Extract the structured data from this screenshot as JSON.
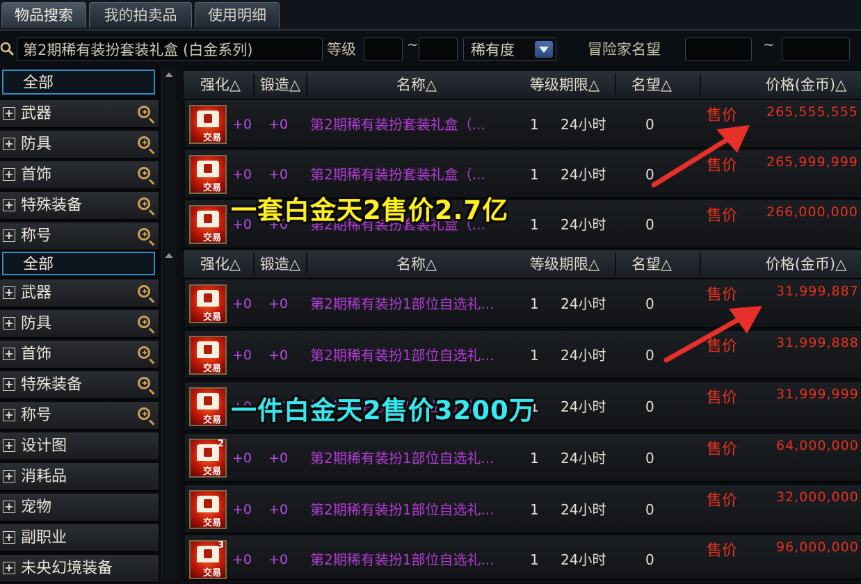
{
  "tabs": [
    {
      "label": "物品搜索",
      "active": true
    },
    {
      "label": "我的拍卖品",
      "active": false
    },
    {
      "label": "使用明细",
      "active": false
    }
  ],
  "search": {
    "value": "第2期稀有装扮套装礼盒 (白金系列)",
    "level_label": "等级",
    "tilde": "~",
    "rarity_label": "稀有度",
    "fame_label": "冒险家名望"
  },
  "sidebar": {
    "group1": {
      "all": "全部",
      "items": [
        "武器",
        "防具",
        "首饰",
        "特殊装备",
        "称号"
      ]
    },
    "group2": {
      "all": "全部",
      "items": [
        "武器",
        "防具",
        "首饰",
        "特殊装备",
        "称号",
        "设计图",
        "消耗品",
        "宠物",
        "副职业",
        "未央幻境装备"
      ]
    }
  },
  "columns": {
    "enhance": "强化△",
    "forge": "锻造△",
    "name": "名称△",
    "level_duration": "等级期限△",
    "fame": "名望△",
    "price": "价格(金币)△"
  },
  "item_icon_label": "交易",
  "sell_label": "售价",
  "table1": [
    {
      "enhance": "+0",
      "forge": "+0",
      "name": "第2期稀有装扮套装礼盒（...",
      "level": "1",
      "duration": "24小时",
      "fame": "0",
      "price": "265,555,555"
    },
    {
      "enhance": "+0",
      "forge": "+0",
      "name": "第2期稀有装扮套装礼盒（...",
      "level": "1",
      "duration": "24小时",
      "fame": "0",
      "price": "265,999,999"
    },
    {
      "enhance": "+0",
      "forge": "+0",
      "name": "第2期稀有装扮套装礼盒（...",
      "level": "1",
      "duration": "24小时",
      "fame": "0",
      "price": "266,000,000"
    }
  ],
  "table2": [
    {
      "enhance": "+0",
      "forge": "+0",
      "name": "第2期稀有装扮1部位自选礼...",
      "level": "1",
      "duration": "24小时",
      "fame": "0",
      "price": "31,999,887",
      "count": ""
    },
    {
      "enhance": "+0",
      "forge": "+0",
      "name": "第2期稀有装扮1部位自选礼...",
      "level": "1",
      "duration": "24小时",
      "fame": "0",
      "price": "31,999,888",
      "count": ""
    },
    {
      "enhance": "+0",
      "forge": "+0",
      "name": "第2期稀有装扮1部位自选礼...",
      "level": "1",
      "duration": "24小时",
      "fame": "0",
      "price": "31,999,999",
      "count": ""
    },
    {
      "enhance": "+0",
      "forge": "+0",
      "name": "第2期稀有装扮1部位自选礼...",
      "level": "1",
      "duration": "24小时",
      "fame": "0",
      "price": "64,000,000",
      "count": "2"
    },
    {
      "enhance": "+0",
      "forge": "+0",
      "name": "第2期稀有装扮1部位自选礼...",
      "level": "1",
      "duration": "24小时",
      "fame": "0",
      "price": "32,000,000",
      "count": ""
    },
    {
      "enhance": "+0",
      "forge": "+0",
      "name": "第2期稀有装扮1部位自选礼...",
      "level": "1",
      "duration": "24小时",
      "fame": "0",
      "price": "96,000,000",
      "count": "3"
    }
  ],
  "annotations": {
    "set_price": "一套白金天2售价2.7亿",
    "piece_price": "一件白金天2售价3200万"
  },
  "colors": {
    "price_red": "#e8321e",
    "name_purple": "#b43cd6",
    "anno_yellow": "#fff020",
    "anno_cyan": "#38e8f0",
    "arrow_red": "#e8302a",
    "selected_blue": "#2d8fc6"
  }
}
